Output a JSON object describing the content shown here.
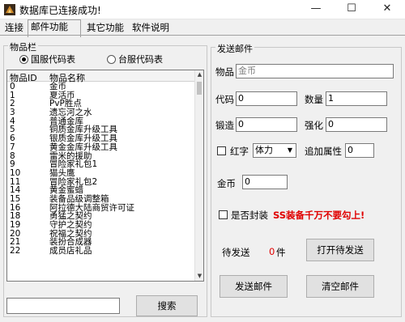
{
  "window": {
    "title": "数据库已连接成功!",
    "minimize": "—",
    "maximize": "☐",
    "close": "✕"
  },
  "tabs": [
    "连接",
    "邮件功能",
    "其它功能",
    "软件说明"
  ],
  "items_panel": {
    "title": "物品栏",
    "radio_national": "国服代码表",
    "radio_taiwan": "台服代码表",
    "col_id": "物品ID",
    "col_name": "物品名称",
    "rows": [
      {
        "id": "0",
        "name": "金币"
      },
      {
        "id": "1",
        "name": "夏活币"
      },
      {
        "id": "2",
        "name": "PvP胜点"
      },
      {
        "id": "3",
        "name": "遗忘河之水"
      },
      {
        "id": "4",
        "name": "普通金库"
      },
      {
        "id": "5",
        "name": "铜质金库升级工具"
      },
      {
        "id": "6",
        "name": "银质金库升级工具"
      },
      {
        "id": "7",
        "name": "黄金金库升级工具"
      },
      {
        "id": "8",
        "name": "雷米的援助"
      },
      {
        "id": "9",
        "name": "冒险家礼包1"
      },
      {
        "id": "10",
        "name": "猫头鹰"
      },
      {
        "id": "11",
        "name": "冒险家礼包2"
      },
      {
        "id": "14",
        "name": "黄金蜜蜡"
      },
      {
        "id": "15",
        "name": "装备品级调整箱"
      },
      {
        "id": "16",
        "name": "阿拉德大陆商贸许可证"
      },
      {
        "id": "18",
        "name": "勇猛之契约"
      },
      {
        "id": "19",
        "name": "守护之契约"
      },
      {
        "id": "20",
        "name": "祝福之契约"
      },
      {
        "id": "21",
        "name": "装扮合成器"
      },
      {
        "id": "22",
        "name": "成员店礼品"
      }
    ],
    "search_value": "",
    "search_button": "搜索"
  },
  "mail_panel": {
    "title": "发送邮件",
    "item_label": "物品",
    "item_value": "金币",
    "code_label": "代码",
    "code_value": "0",
    "qty_label": "数量",
    "qty_value": "1",
    "forge_label": "锻造",
    "forge_value": "0",
    "strengthen_label": "强化",
    "strengthen_value": "0",
    "red_label": "红字",
    "red_select": "体力",
    "extra_label": "追加属性",
    "extra_value": "0",
    "gold_label": "金币",
    "gold_value": "0",
    "seal_label": "是否封装",
    "seal_warning": "SS装备千万不要勾上!",
    "pending_label": "待发送",
    "pending_count": "0",
    "pending_unit": "件",
    "open_pending_button": "打开待发送",
    "send_button": "发送邮件",
    "clear_button": "清空邮件"
  },
  "colors": {
    "warning": "#e00000",
    "count": "#e00000",
    "disabled_text": "#808080"
  }
}
